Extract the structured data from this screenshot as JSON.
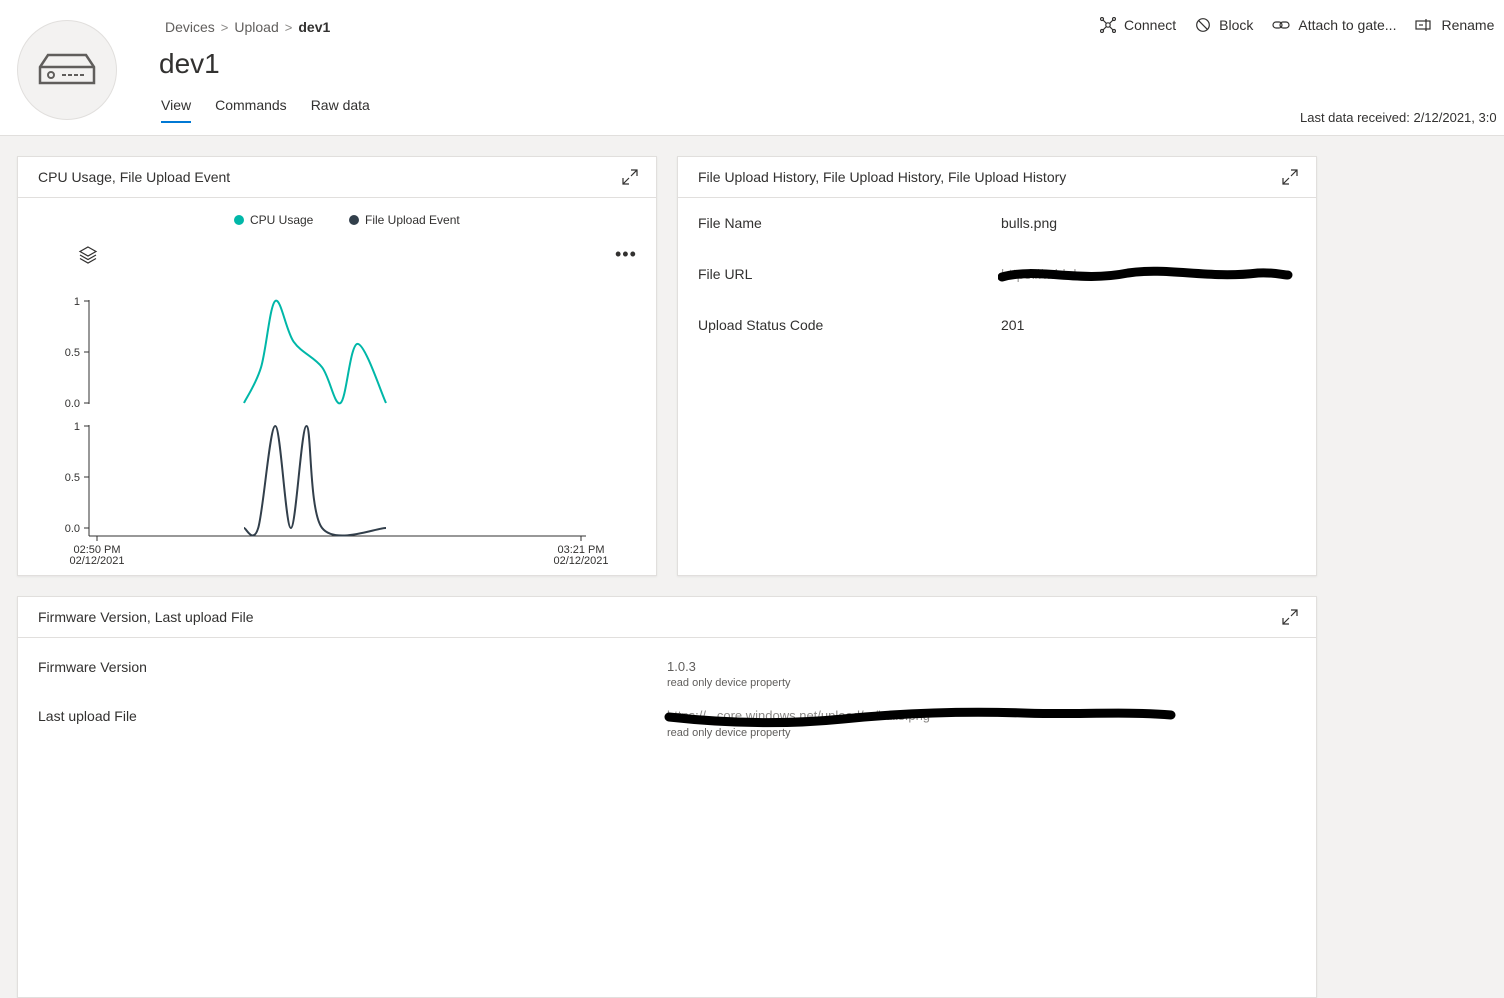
{
  "breadcrumb": {
    "devices": "Devices",
    "upload": "Upload",
    "current": "dev1"
  },
  "device": {
    "title": "dev1"
  },
  "tabs": [
    "View",
    "Commands",
    "Raw data"
  ],
  "toolbar": {
    "connect": "Connect",
    "block": "Block",
    "attach": "Attach to gate...",
    "rename": "Rename"
  },
  "last_received": "Last data received: 2/12/2021, 3:0",
  "card1": {
    "title": "CPU Usage, File Upload Event",
    "legend": [
      "CPU Usage",
      "File Upload Event"
    ],
    "x_start": "02:50 PM",
    "x_start_date": "02/12/2021",
    "x_end": "03:21 PM",
    "x_end_date": "02/12/2021"
  },
  "chart_data": {
    "type": "line",
    "series": [
      {
        "name": "CPU Usage",
        "color": "#00b7a8",
        "points": [
          [
            0.0,
            0.0
          ],
          [
            0.12,
            0.35
          ],
          [
            0.22,
            1.0
          ],
          [
            0.35,
            0.6
          ],
          [
            0.55,
            0.35
          ],
          [
            0.68,
            0.0
          ],
          [
            0.8,
            0.58
          ],
          [
            1.0,
            0.0
          ]
        ]
      },
      {
        "name": "File Upload Event",
        "color": "#323f4b",
        "points": [
          [
            0.0,
            0.0
          ],
          [
            0.1,
            0.0
          ],
          [
            0.22,
            1.0
          ],
          [
            0.33,
            0.0
          ],
          [
            0.44,
            1.0
          ],
          [
            0.55,
            0.0
          ],
          [
            1.0,
            0.0
          ]
        ]
      }
    ],
    "yticks": [
      "1",
      "0.5",
      "0.0"
    ],
    "ylim": [
      0,
      1
    ],
    "xlabel": "",
    "ylabel": "",
    "grid": false,
    "legend_position": "top"
  },
  "card2": {
    "title": "File Upload History, File Upload History, File Upload History",
    "rows": [
      {
        "label": "File Name",
        "value": "bulls.png"
      },
      {
        "label": "File URL",
        "value": "https://...blob..."
      },
      {
        "label": "Upload Status Code",
        "value": "201"
      }
    ]
  },
  "card3": {
    "title": "Firmware Version, Last upload File",
    "rows": [
      {
        "label": "Firmware Version",
        "value": "1.0.3",
        "note": "read only device property"
      },
      {
        "label": "Last upload File",
        "value": "https://...core.windows.net/upload/.../bulls.png",
        "note": "read only device property"
      }
    ]
  }
}
